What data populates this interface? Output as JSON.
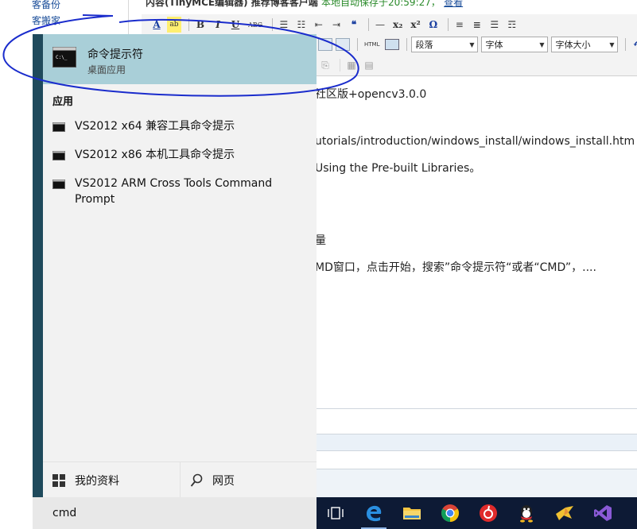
{
  "background": {
    "sidebar_links": [
      "客备份",
      "客搬家"
    ],
    "top_line": {
      "label": "内容(TinyMCE编辑器)",
      "promo": "推荐博客客户端",
      "autosave": "本地自动保存于20:59:27，",
      "view_link": "查看"
    },
    "toolbar": {
      "row1": [
        "A",
        "ab",
        "B",
        "I",
        "U",
        "ABC",
        "☰",
        "☷",
        "⇤",
        "⇥",
        "❝",
        "—",
        "x₂",
        "x²",
        "Ω",
        "≡",
        "≣",
        "☰",
        "☶"
      ],
      "paragraph_select": "段落",
      "font_select": "字体",
      "size_select": "字体大小",
      "html_button": "HTML"
    },
    "editor_lines": [
      "社区版+opencv3.0.0",
      "utorials/introduction/windows_install/windows_install.htm",
      "Using the Pre-built Libraries。",
      "量",
      "MD窗口，点击开始，搜索”命令提示符“或者“CMD”，...."
    ]
  },
  "start_menu": {
    "best_match": {
      "title": "命令提示符",
      "subtitle": "桌面应用"
    },
    "section_label": "应用",
    "apps": [
      "VS2012 x64 兼容工具命令提示",
      "VS2012 x86 本机工具命令提示",
      "VS2012 ARM Cross Tools Command Prompt"
    ],
    "bottom": {
      "my_stuff": "我的资料",
      "web": "网页"
    },
    "search_value": "cmd"
  },
  "colors": {
    "start_bg": "#f2f2f2",
    "highlight": "#a9cfd8",
    "rail": "#1f4a5c",
    "taskbar": "#0d1a35",
    "annotation": "#1a2ccc"
  }
}
